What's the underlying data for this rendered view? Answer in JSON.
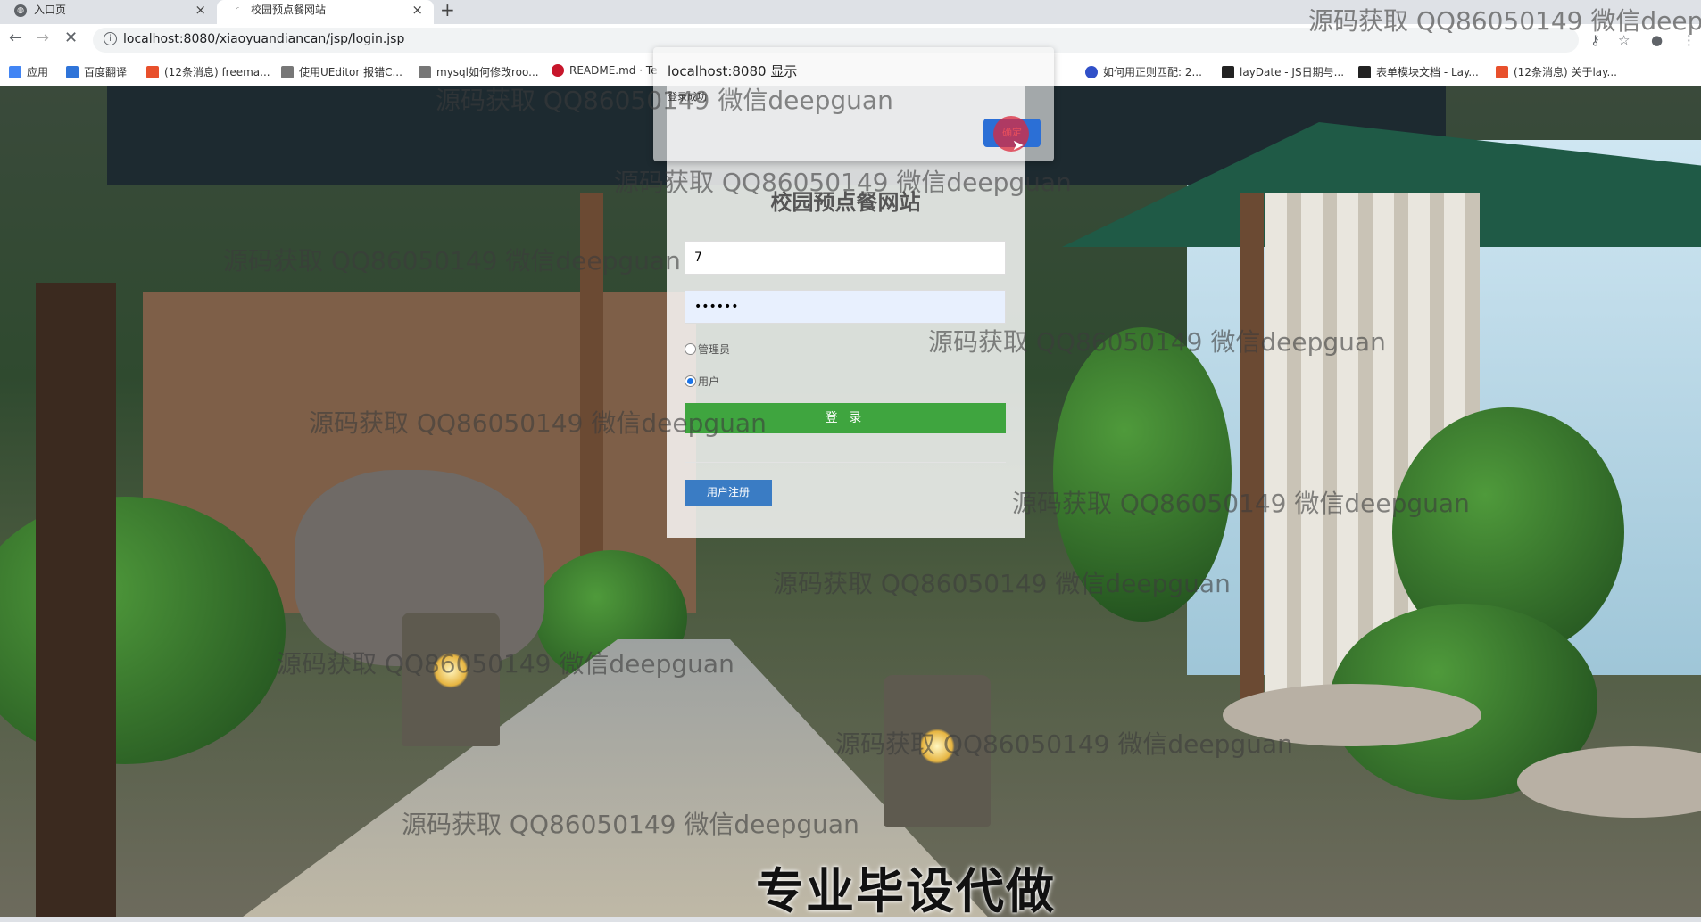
{
  "browser": {
    "tabs": [
      {
        "title": "入口页",
        "active": false
      },
      {
        "title": "校园预点餐网站",
        "active": true
      }
    ],
    "url": "localhost:8080/xiaoyuandiancan/jsp/login.jsp",
    "bookmarks": [
      {
        "label": "应用",
        "color": "#4285f4"
      },
      {
        "label": "百度翻译",
        "color": "#2f74d9"
      },
      {
        "label": "(12条消息) freema...",
        "color": "#e8502c"
      },
      {
        "label": "使用UEditor 报错C...",
        "color": "#444444"
      },
      {
        "label": "mysql如何修改roo...",
        "color": "#444444"
      },
      {
        "label": "README.md · Te",
        "color": "#c7162b"
      },
      {
        "label": "如何用正则匹配: 2...",
        "color": "#3050c8"
      },
      {
        "label": "layDate - JS日期与...",
        "color": "#222222"
      },
      {
        "label": "表单模块文档 - Lay...",
        "color": "#222222"
      },
      {
        "label": "(12条消息) 关于lay...",
        "color": "#e8502c"
      }
    ]
  },
  "dialog": {
    "title": "localhost:8080 显示",
    "message": "登录成功",
    "ok_label": "确定"
  },
  "login": {
    "title": "校园预点餐网站",
    "username_value": "7",
    "password_value": "••••••",
    "roles": [
      {
        "label": "管理员",
        "checked": false
      },
      {
        "label": "用户",
        "checked": true
      }
    ],
    "login_button": "登 录",
    "register_button": "用户注册"
  },
  "overlay": {
    "watermark": "源码获取 QQ86050149 微信deepguan",
    "caption": "专业毕设代做"
  }
}
